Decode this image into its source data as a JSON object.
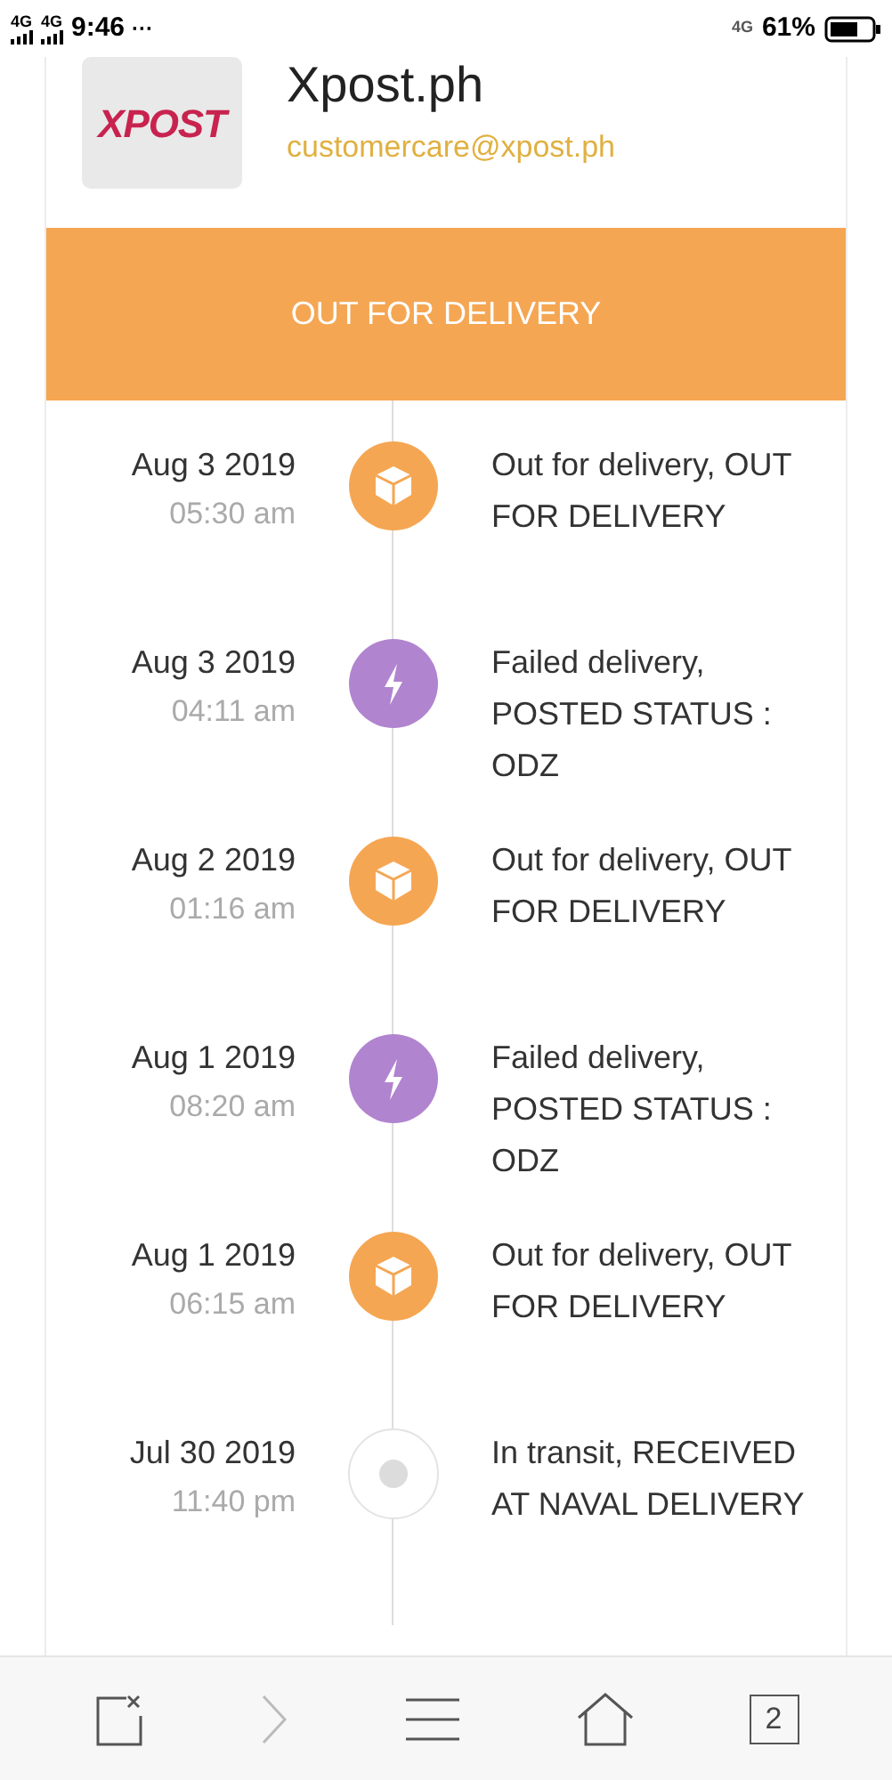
{
  "status_bar": {
    "sim1": "4G",
    "sim2": "4G",
    "time": "9:46",
    "more": "···",
    "network": "4G",
    "battery": "61%"
  },
  "company": {
    "logo": "XPOST",
    "name": "Xpost.ph",
    "email": "customercare@xpost.ph"
  },
  "status_banner": "OUT FOR DELIVERY",
  "events": [
    {
      "date": "Aug 3 2019",
      "time": "05:30 am",
      "kind": "box",
      "text": "Out for delivery, OUT FOR DELIVERY"
    },
    {
      "date": "Aug 3 2019",
      "time": "04:11 am",
      "kind": "bolt",
      "text": "Failed delivery, POSTED STATUS : ODZ"
    },
    {
      "date": "Aug 2 2019",
      "time": "01:16 am",
      "kind": "box",
      "text": "Out for delivery, OUT FOR DELIVERY"
    },
    {
      "date": "Aug 1 2019",
      "time": "08:20 am",
      "kind": "bolt",
      "text": "Failed delivery, POSTED STATUS : ODZ"
    },
    {
      "date": "Aug 1 2019",
      "time": "06:15 am",
      "kind": "box",
      "text": "Out for delivery, OUT FOR DELIVERY"
    },
    {
      "date": "Jul 30 2019",
      "time": "11:40 pm",
      "kind": "dot",
      "text": "In transit, RECEIVED AT NAVAL DELIVERY"
    }
  ],
  "bottom_bar": {
    "tabs_count": "2"
  }
}
